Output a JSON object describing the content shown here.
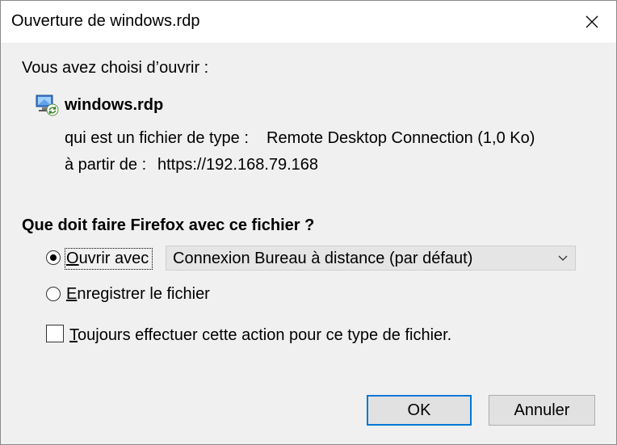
{
  "window": {
    "title": "Ouverture de windows.rdp"
  },
  "intro": "Vous avez choisi d’ouvrir :",
  "file": {
    "name": "windows.rdp",
    "type_label": "qui est un fichier de type :",
    "type_value": "Remote Desktop Connection (1,0 Ko)",
    "source_label": "à partir de :",
    "source_value": "https://192.168.79.168",
    "icon": "remote-desktop-file-icon"
  },
  "question": "Que doit faire Firefox avec ce fichier ?",
  "options": {
    "open_with": {
      "accel": "O",
      "rest": "uvrir avec",
      "checked": true
    },
    "open_with_app": "Connexion Bureau à distance (par défaut)",
    "save": {
      "accel": "E",
      "rest": "nregistrer le fichier",
      "checked": false
    },
    "always": {
      "accel": "T",
      "rest": "oujours effectuer cette action pour ce type de fichier.",
      "checked": false
    }
  },
  "buttons": {
    "ok": "OK",
    "cancel": "Annuler"
  },
  "colors": {
    "dialog_bg": "#f0f0f0",
    "titlebar_bg": "#ffffff",
    "default_button_border": "#0078d7",
    "dropdown_bg": "#e5e5e5"
  }
}
